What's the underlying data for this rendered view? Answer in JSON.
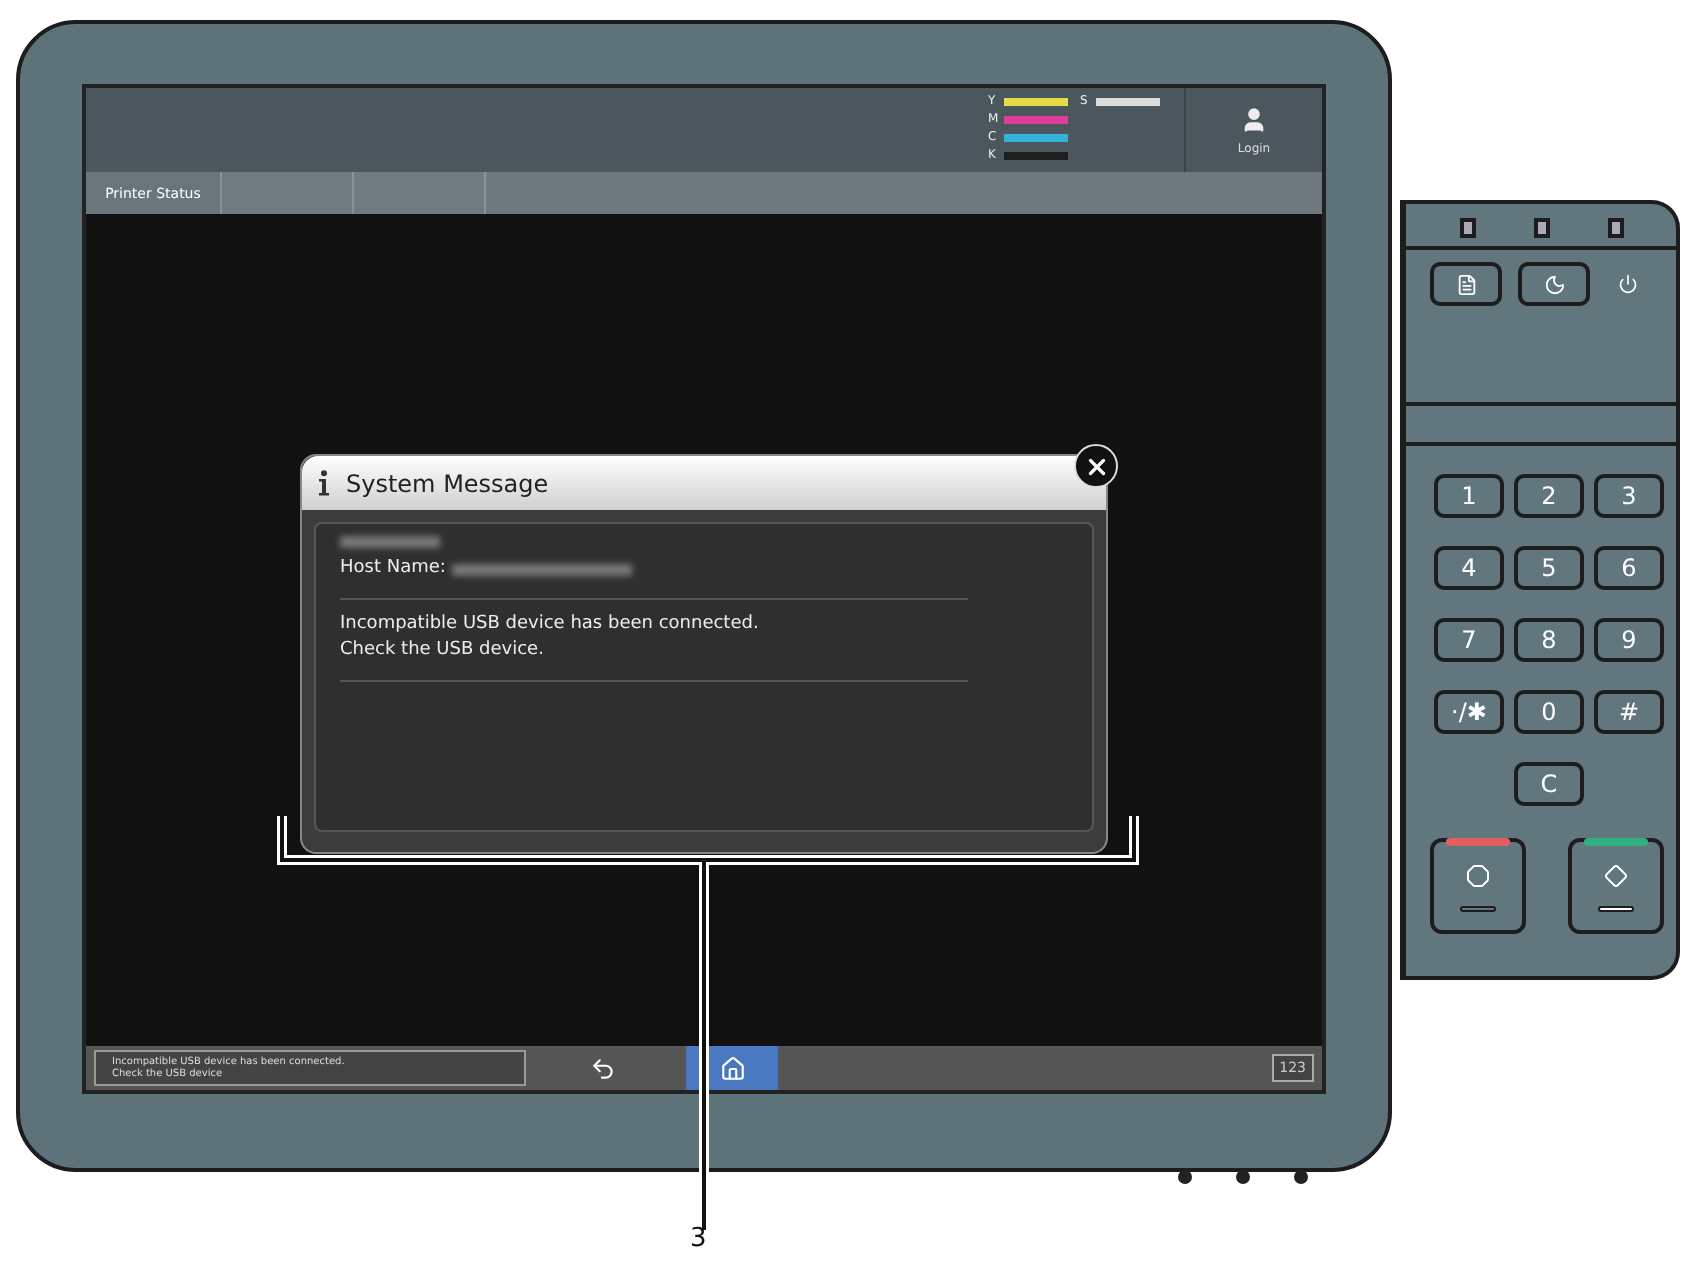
{
  "header": {
    "toner": [
      {
        "label": "Y",
        "color": "#e6dc48",
        "level": 1
      },
      {
        "label": "M",
        "color": "#de3f98",
        "level": 1
      },
      {
        "label": "C",
        "color": "#33b3d9",
        "level": 1
      },
      {
        "label": "K",
        "color": "#1e1e1e",
        "level": 1
      }
    ],
    "waste": {
      "label": "S",
      "level": 1
    },
    "login": "Login"
  },
  "tabs": [
    {
      "label": "Printer Status",
      "selected": true
    },
    {
      "selected": false
    },
    {
      "selected": false
    }
  ],
  "dialog": {
    "title": "System Message",
    "host_label": "Host Name:",
    "message": [
      "Incompatible USB device has been connected.",
      "Check the USB device."
    ]
  },
  "bottom_bar": {
    "status": [
      "Incompatible USB device has been connected.",
      "Check the USB device"
    ],
    "home_selected": true,
    "keypad_toggle": "123"
  },
  "control_panel": {
    "keys": [
      "1",
      "2",
      "3",
      "4",
      "5",
      "6",
      "7",
      "8",
      "9",
      "·/✱",
      "0",
      "#"
    ],
    "clear": "C"
  },
  "callout": "3"
}
